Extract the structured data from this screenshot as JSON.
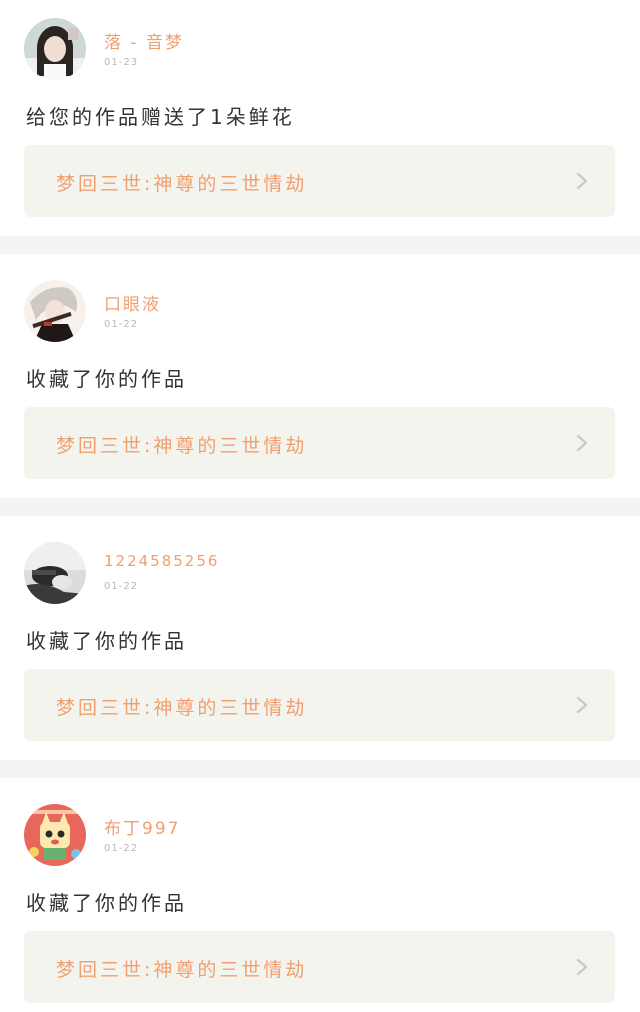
{
  "feed": {
    "items": [
      {
        "username": "落 - 音梦",
        "date": "01-23",
        "action": "给您的作品赠送了1朵鲜花",
        "work_title": "梦回三世:神尊的三世情劫",
        "avatar_icon": "girl-portrait-avatar"
      },
      {
        "username": "口眼液",
        "date": "01-22",
        "action": "收藏了你的作品",
        "work_title": "梦回三世:神尊的三世情劫",
        "avatar_icon": "anime-swordsman-avatar"
      },
      {
        "username": "1224585256",
        "date": "01-22",
        "action": "收藏了你的作品",
        "work_title": "梦回三世:神尊的三世情劫",
        "avatar_icon": "monochrome-portrait-avatar"
      },
      {
        "username": "布丁997",
        "date": "01-22",
        "action": "收藏了你的作品",
        "work_title": "梦回三世:神尊的三世情劫",
        "avatar_icon": "cartoon-character-avatar"
      }
    ]
  },
  "colors": {
    "accent": "#f0a070",
    "action_text": "#333333",
    "date_text": "#b9b9b9",
    "link_bg": "#f4f4ef",
    "separator": "#f3f3f1",
    "chevron": "#c8c8c8"
  }
}
